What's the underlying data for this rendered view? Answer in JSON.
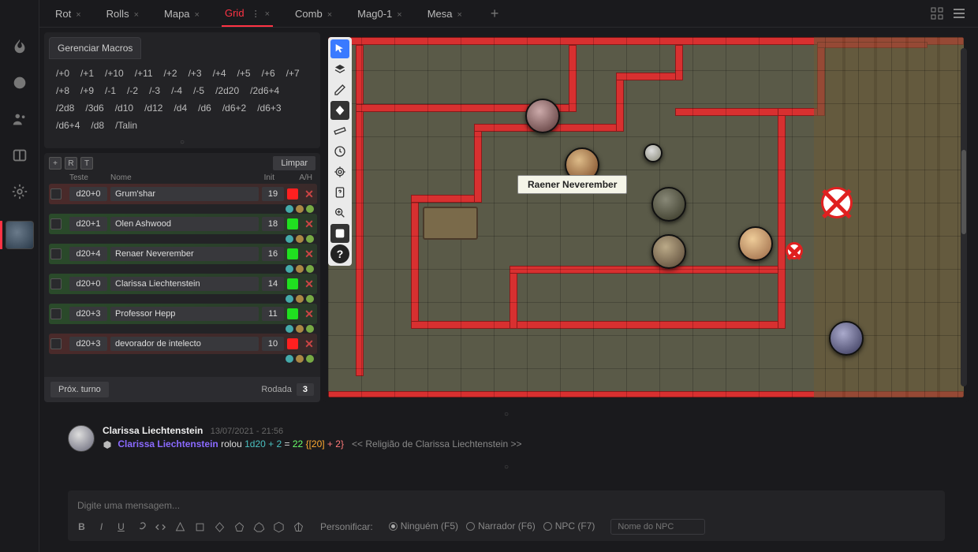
{
  "tabs": [
    {
      "label": "Rot",
      "active": false
    },
    {
      "label": "Rolls",
      "active": false
    },
    {
      "label": "Mapa",
      "active": false
    },
    {
      "label": "Grid",
      "active": true
    },
    {
      "label": "Comb",
      "active": false
    },
    {
      "label": "Mag0-1",
      "active": false
    },
    {
      "label": "Mesa",
      "active": false
    }
  ],
  "macros": {
    "header": "Gerenciar Macros",
    "items": [
      "/+0",
      "/+1",
      "/+10",
      "/+11",
      "/+2",
      "/+3",
      "/+4",
      "/+5",
      "/+6",
      "/+7",
      "/+8",
      "/+9",
      "/-1",
      "/-2",
      "/-3",
      "/-4",
      "/-5",
      "/2d20",
      "/2d6+4",
      "/2d8",
      "/3d6",
      "/d10",
      "/d12",
      "/d4",
      "/d6",
      "/d6+2",
      "/d6+3",
      "/d6+4",
      "/d8",
      "/Talin"
    ]
  },
  "tracker": {
    "buttons": {
      "add": "+",
      "r": "R",
      "t": "T",
      "clear": "Limpar"
    },
    "head": {
      "teste": "Teste",
      "nome": "Nome",
      "init": "Init",
      "ah": "A/H"
    },
    "rows": [
      {
        "test": "d20+0",
        "name": "Grum'shar",
        "init": "19",
        "status": "red",
        "type": "hostile"
      },
      {
        "test": "d20+1",
        "name": "Olen Ashwood",
        "init": "18",
        "status": "green",
        "type": "friendly"
      },
      {
        "test": "d20+4",
        "name": "Renaer Neverember",
        "init": "16",
        "status": "green",
        "type": "friendly"
      },
      {
        "test": "d20+0",
        "name": "Clarissa Liechtenstein",
        "init": "14",
        "status": "green",
        "type": "friendly"
      },
      {
        "test": "d20+3",
        "name": "Professor Hepp",
        "init": "11",
        "status": "green",
        "type": "friendly"
      },
      {
        "test": "d20+3",
        "name": "devorador de intelecto",
        "init": "10",
        "status": "red",
        "type": "hostile"
      }
    ],
    "next": "Próx. turno",
    "round_label": "Rodada",
    "round": "3"
  },
  "map": {
    "token_label": "Raener Neverember",
    "tools": [
      "pointer",
      "layers",
      "pencil",
      "shape",
      "ruler",
      "history",
      "target",
      "help-doc",
      "zoom",
      "dice",
      "question"
    ]
  },
  "chat": {
    "msg": {
      "char": "Clarissa Liechtenstein",
      "time": "13/07/2021 - 21:56",
      "roll_char": "Clarissa Liechtenstein",
      "verb": "rolou",
      "expr": "1d20 + 2",
      "eq": "=",
      "result": "22",
      "detail_open": "{",
      "detail1": "[20]",
      "detail_plus": " + ",
      "detail2": "2",
      "detail_close": "}",
      "source": "<< Religião de Clarissa Liechtenstein >>"
    },
    "placeholder": "Digite uma mensagem...",
    "impersonate_label": "Personificar:",
    "radios": [
      {
        "label": "Ninguém (F5)",
        "selected": true
      },
      {
        "label": "Narrador (F6)",
        "selected": false
      },
      {
        "label": "NPC (F7)",
        "selected": false
      }
    ],
    "npc_placeholder": "Nome do NPC"
  }
}
